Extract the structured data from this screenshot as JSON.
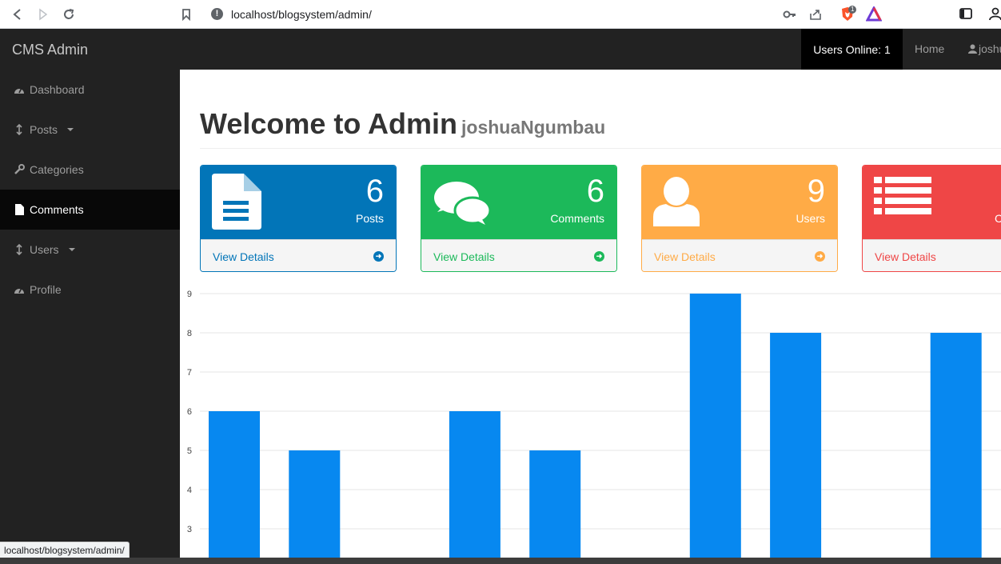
{
  "browser": {
    "url": "localhost/blogsystem/admin/",
    "status_url": "localhost/blogsystem/admin/",
    "brave_badge": "1"
  },
  "header": {
    "brand": "CMS Admin",
    "users_online": "Users Online: 1",
    "home": "Home",
    "user": "joshu"
  },
  "sidebar": {
    "items": [
      {
        "label": "Dashboard",
        "icon": "dashboard-icon"
      },
      {
        "label": "Posts",
        "icon": "arrows-v-icon"
      },
      {
        "label": "Categories",
        "icon": "wrench-icon"
      },
      {
        "label": "Comments",
        "icon": "file-icon"
      },
      {
        "label": "Users",
        "icon": "arrows-v-icon"
      },
      {
        "label": "Profile",
        "icon": "dashboard-icon"
      }
    ]
  },
  "main": {
    "title": "Welcome to Admin",
    "subtitle": "joshuaNgumbau"
  },
  "panels": [
    {
      "count": "6",
      "label": "Posts",
      "link": "View Details",
      "color": "#337ab7",
      "head_color": "#0275b8",
      "icon": "file-text-icon"
    },
    {
      "count": "6",
      "label": "Comments",
      "link": "View Details",
      "color": "#1cb95a",
      "head_color": "#1cb95a",
      "icon": "comments-icon"
    },
    {
      "count": "9",
      "label": "Users",
      "link": "View Details",
      "color": "#f0ad4e",
      "head_color": "#ffab46",
      "icon": "user-icon"
    },
    {
      "count": "",
      "label": "Ca",
      "link": "View Details",
      "color": "#d9534f",
      "head_color": "#ef4646",
      "icon": "list-icon"
    }
  ],
  "chart_data": {
    "type": "bar",
    "values": [
      6,
      5,
      null,
      6,
      5,
      null,
      9,
      8,
      null,
      8
    ],
    "y_ticks": [
      "9",
      "8",
      "7",
      "6",
      "5",
      "4",
      "3"
    ],
    "ylim": [
      3,
      9
    ],
    "grid": true,
    "color": "#0788f0"
  }
}
